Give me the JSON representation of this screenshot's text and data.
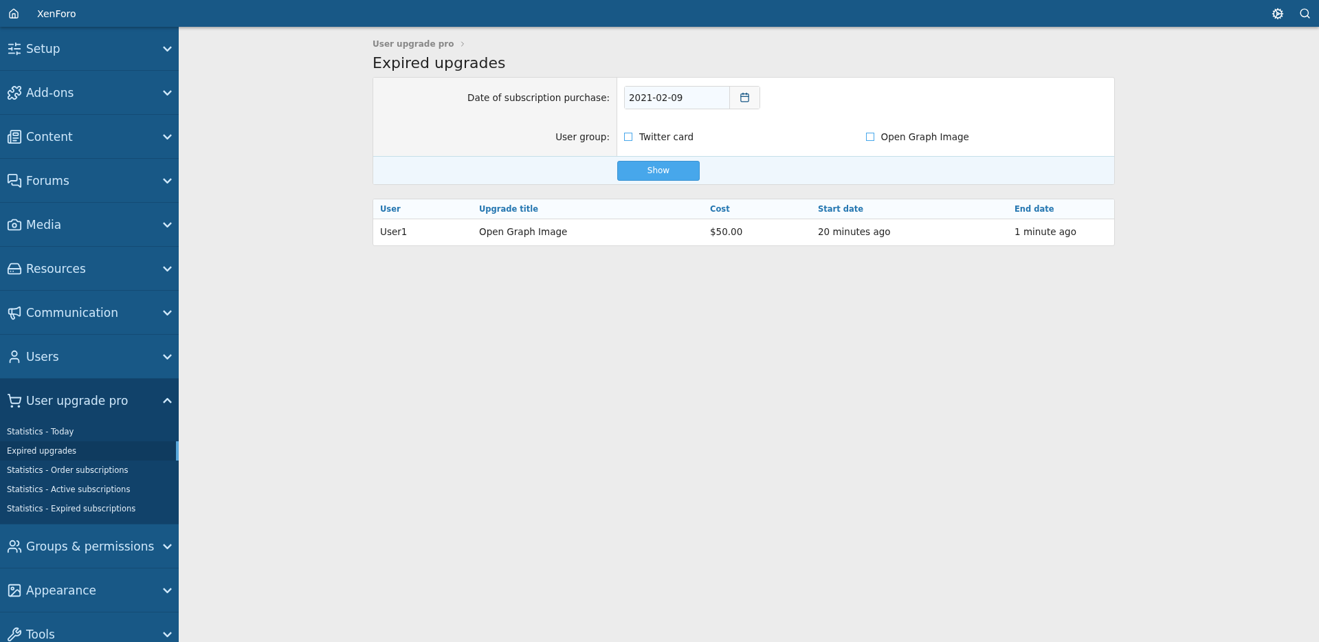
{
  "header": {
    "title": "XenForo"
  },
  "sidebar": {
    "items": [
      {
        "label": "Setup",
        "expanded": false
      },
      {
        "label": "Add-ons",
        "expanded": false
      },
      {
        "label": "Content",
        "expanded": false
      },
      {
        "label": "Forums",
        "expanded": false
      },
      {
        "label": "Media",
        "expanded": false
      },
      {
        "label": "Resources",
        "expanded": false
      },
      {
        "label": "Communication",
        "expanded": false
      },
      {
        "label": "Users",
        "expanded": false
      },
      {
        "label": "User upgrade pro",
        "expanded": true,
        "children": [
          {
            "label": "Statistics - Today",
            "selected": false
          },
          {
            "label": "Expired upgrades",
            "selected": true
          },
          {
            "label": "Statistics - Order subscriptions",
            "selected": false
          },
          {
            "label": "Statistics - Active subscriptions",
            "selected": false
          },
          {
            "label": "Statistics - Expired subscriptions",
            "selected": false
          }
        ]
      },
      {
        "label": "Groups & permissions",
        "expanded": false
      },
      {
        "label": "Appearance",
        "expanded": false
      },
      {
        "label": "Tools",
        "expanded": false
      }
    ]
  },
  "breadcrumb": [
    "User upgrade pro"
  ],
  "page_title": "Expired upgrades",
  "form": {
    "date_label": "Date of subscription purchase:",
    "date_value": "2021-02-09",
    "group_label": "User group:",
    "groups": [
      {
        "label": "Twitter card",
        "checked": false
      },
      {
        "label": "Open Graph Image",
        "checked": false
      }
    ],
    "submit": "Show"
  },
  "table": {
    "columns": [
      "User",
      "Upgrade title",
      "Cost",
      "Start date",
      "End date"
    ],
    "rows": [
      [
        "User1",
        "Open Graph Image",
        "$50.00",
        "20 minutes ago",
        "1 minute ago"
      ]
    ]
  }
}
